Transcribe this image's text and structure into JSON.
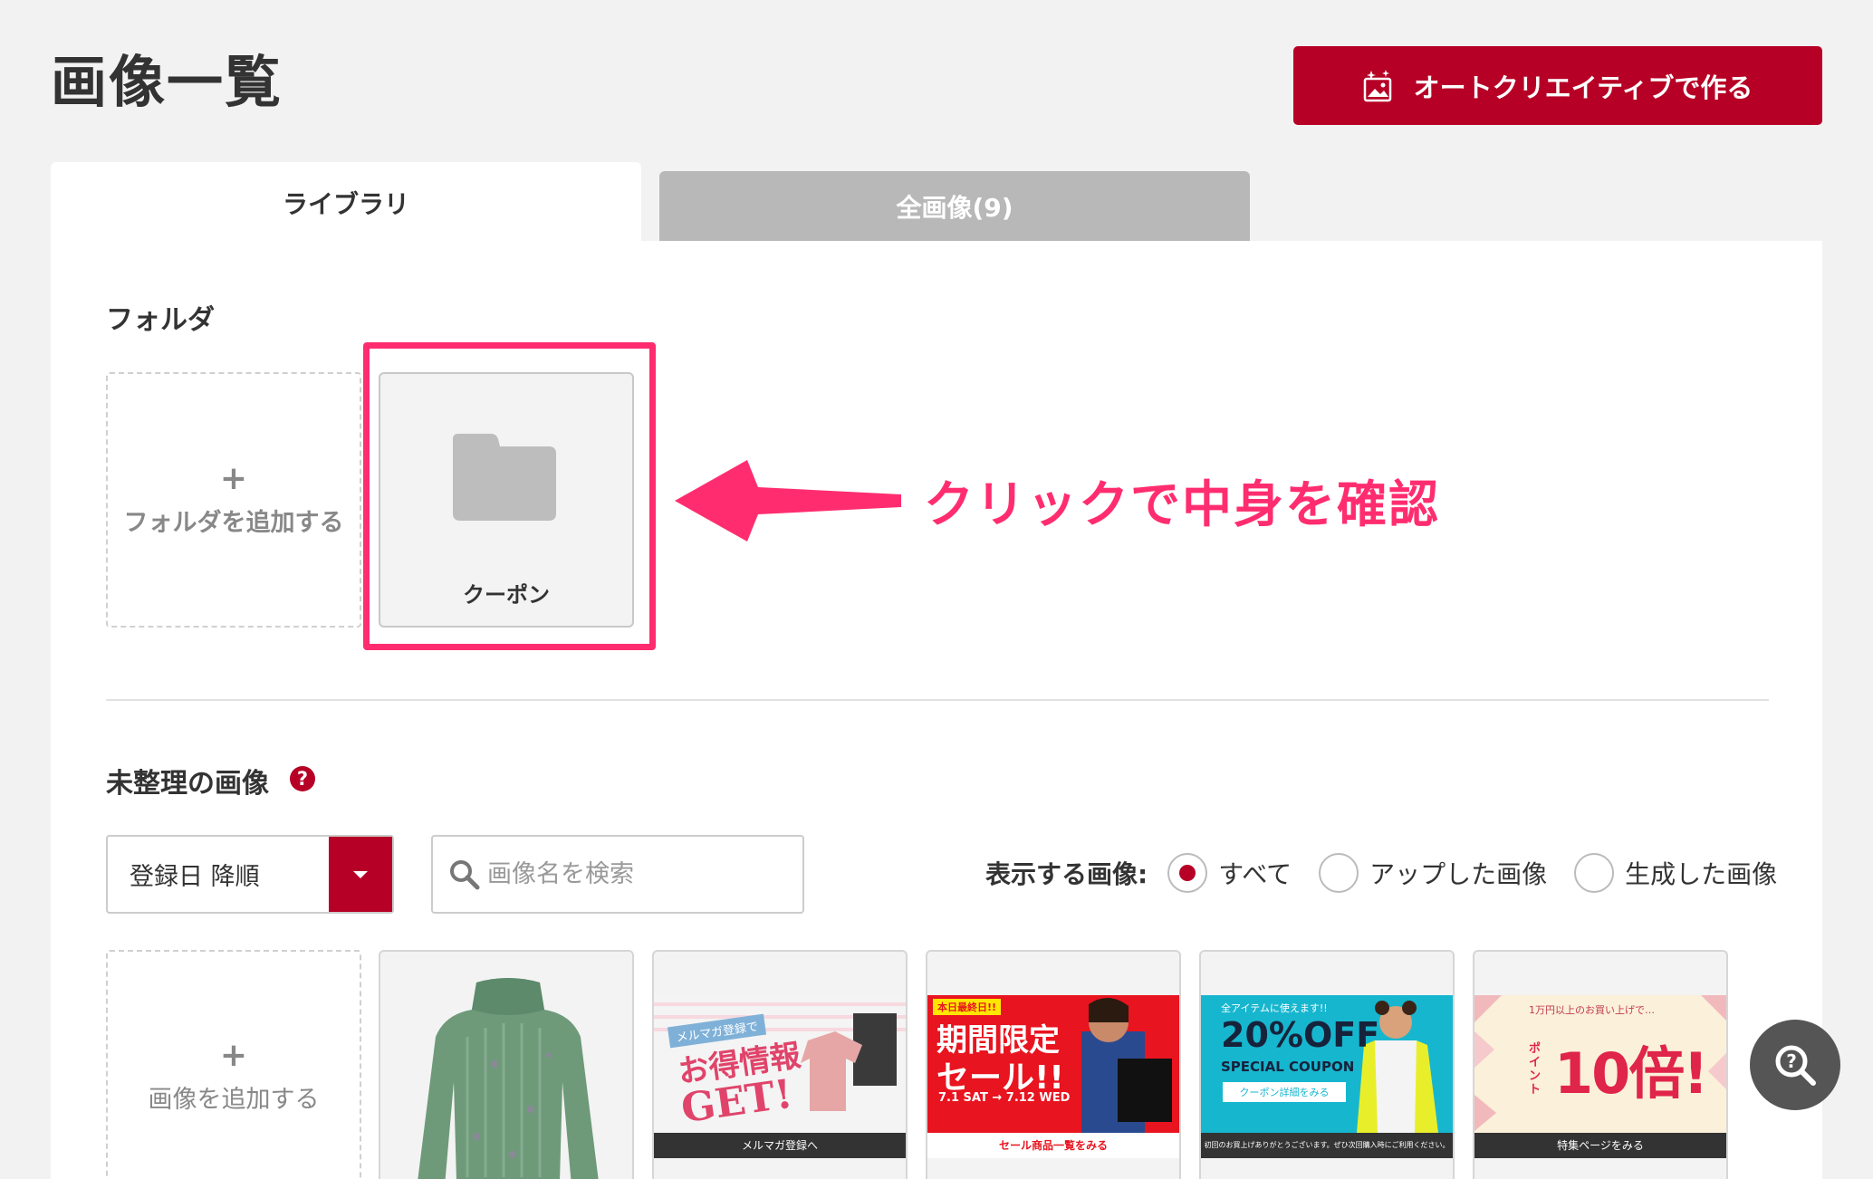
{
  "page": {
    "title": "画像一覧"
  },
  "header": {
    "auto_create_button": "オートクリエイティブで作る"
  },
  "tabs": [
    {
      "label": "ライブラリ",
      "active": true
    },
    {
      "label": "全画像(9)",
      "active": false
    }
  ],
  "folders": {
    "section_title": "フォルダ",
    "add_label": "フォルダを追加する",
    "add_plus": "+",
    "items": [
      {
        "name": "クーポン"
      }
    ]
  },
  "annotation": {
    "text": "クリックで中身を確認",
    "color": "#ff2d6f"
  },
  "unsorted": {
    "section_title": "未整理の画像",
    "help_icon": "?",
    "sort": {
      "value": "登録日 降順"
    },
    "search": {
      "placeholder": "画像名を検索"
    },
    "filter": {
      "label": "表示する画像:",
      "options": [
        {
          "label": "すべて",
          "checked": true
        },
        {
          "label": "アップした画像",
          "checked": false
        },
        {
          "label": "生成した画像",
          "checked": false
        }
      ]
    },
    "add_image_label": "画像を追加する",
    "add_plus": "+",
    "images": [
      {
        "name": "sweater"
      },
      {
        "name": "mailmag-banner",
        "headline": "お得情報",
        "big": "GET!",
        "tag": "メルマガ登録で",
        "bar": "メルマガ登録へ"
      },
      {
        "name": "sale-banner",
        "tag": "本日最終日!!",
        "headline": "期間限定",
        "big": "セール!!",
        "dates": "7.1 SAT → 7.12 WED",
        "bar": "セール商品一覧をみる"
      },
      {
        "name": "coupon-banner",
        "tag": "全アイテムに使えます!!",
        "headline": "20%OFF",
        "big": "SPECIAL COUPON",
        "button": "クーポン詳細をみる",
        "bar": "初回のお買上げありがとうございます。ぜひ次回購入時にご利用ください。"
      },
      {
        "name": "point-banner",
        "tag": "1万円以上のお買い上げで…",
        "headline": "ポイント",
        "big": "10倍!",
        "bar": "特集ページをみる"
      }
    ]
  },
  "colors": {
    "brand": "#b60025",
    "tab_inactive": "#b8b8b8"
  }
}
